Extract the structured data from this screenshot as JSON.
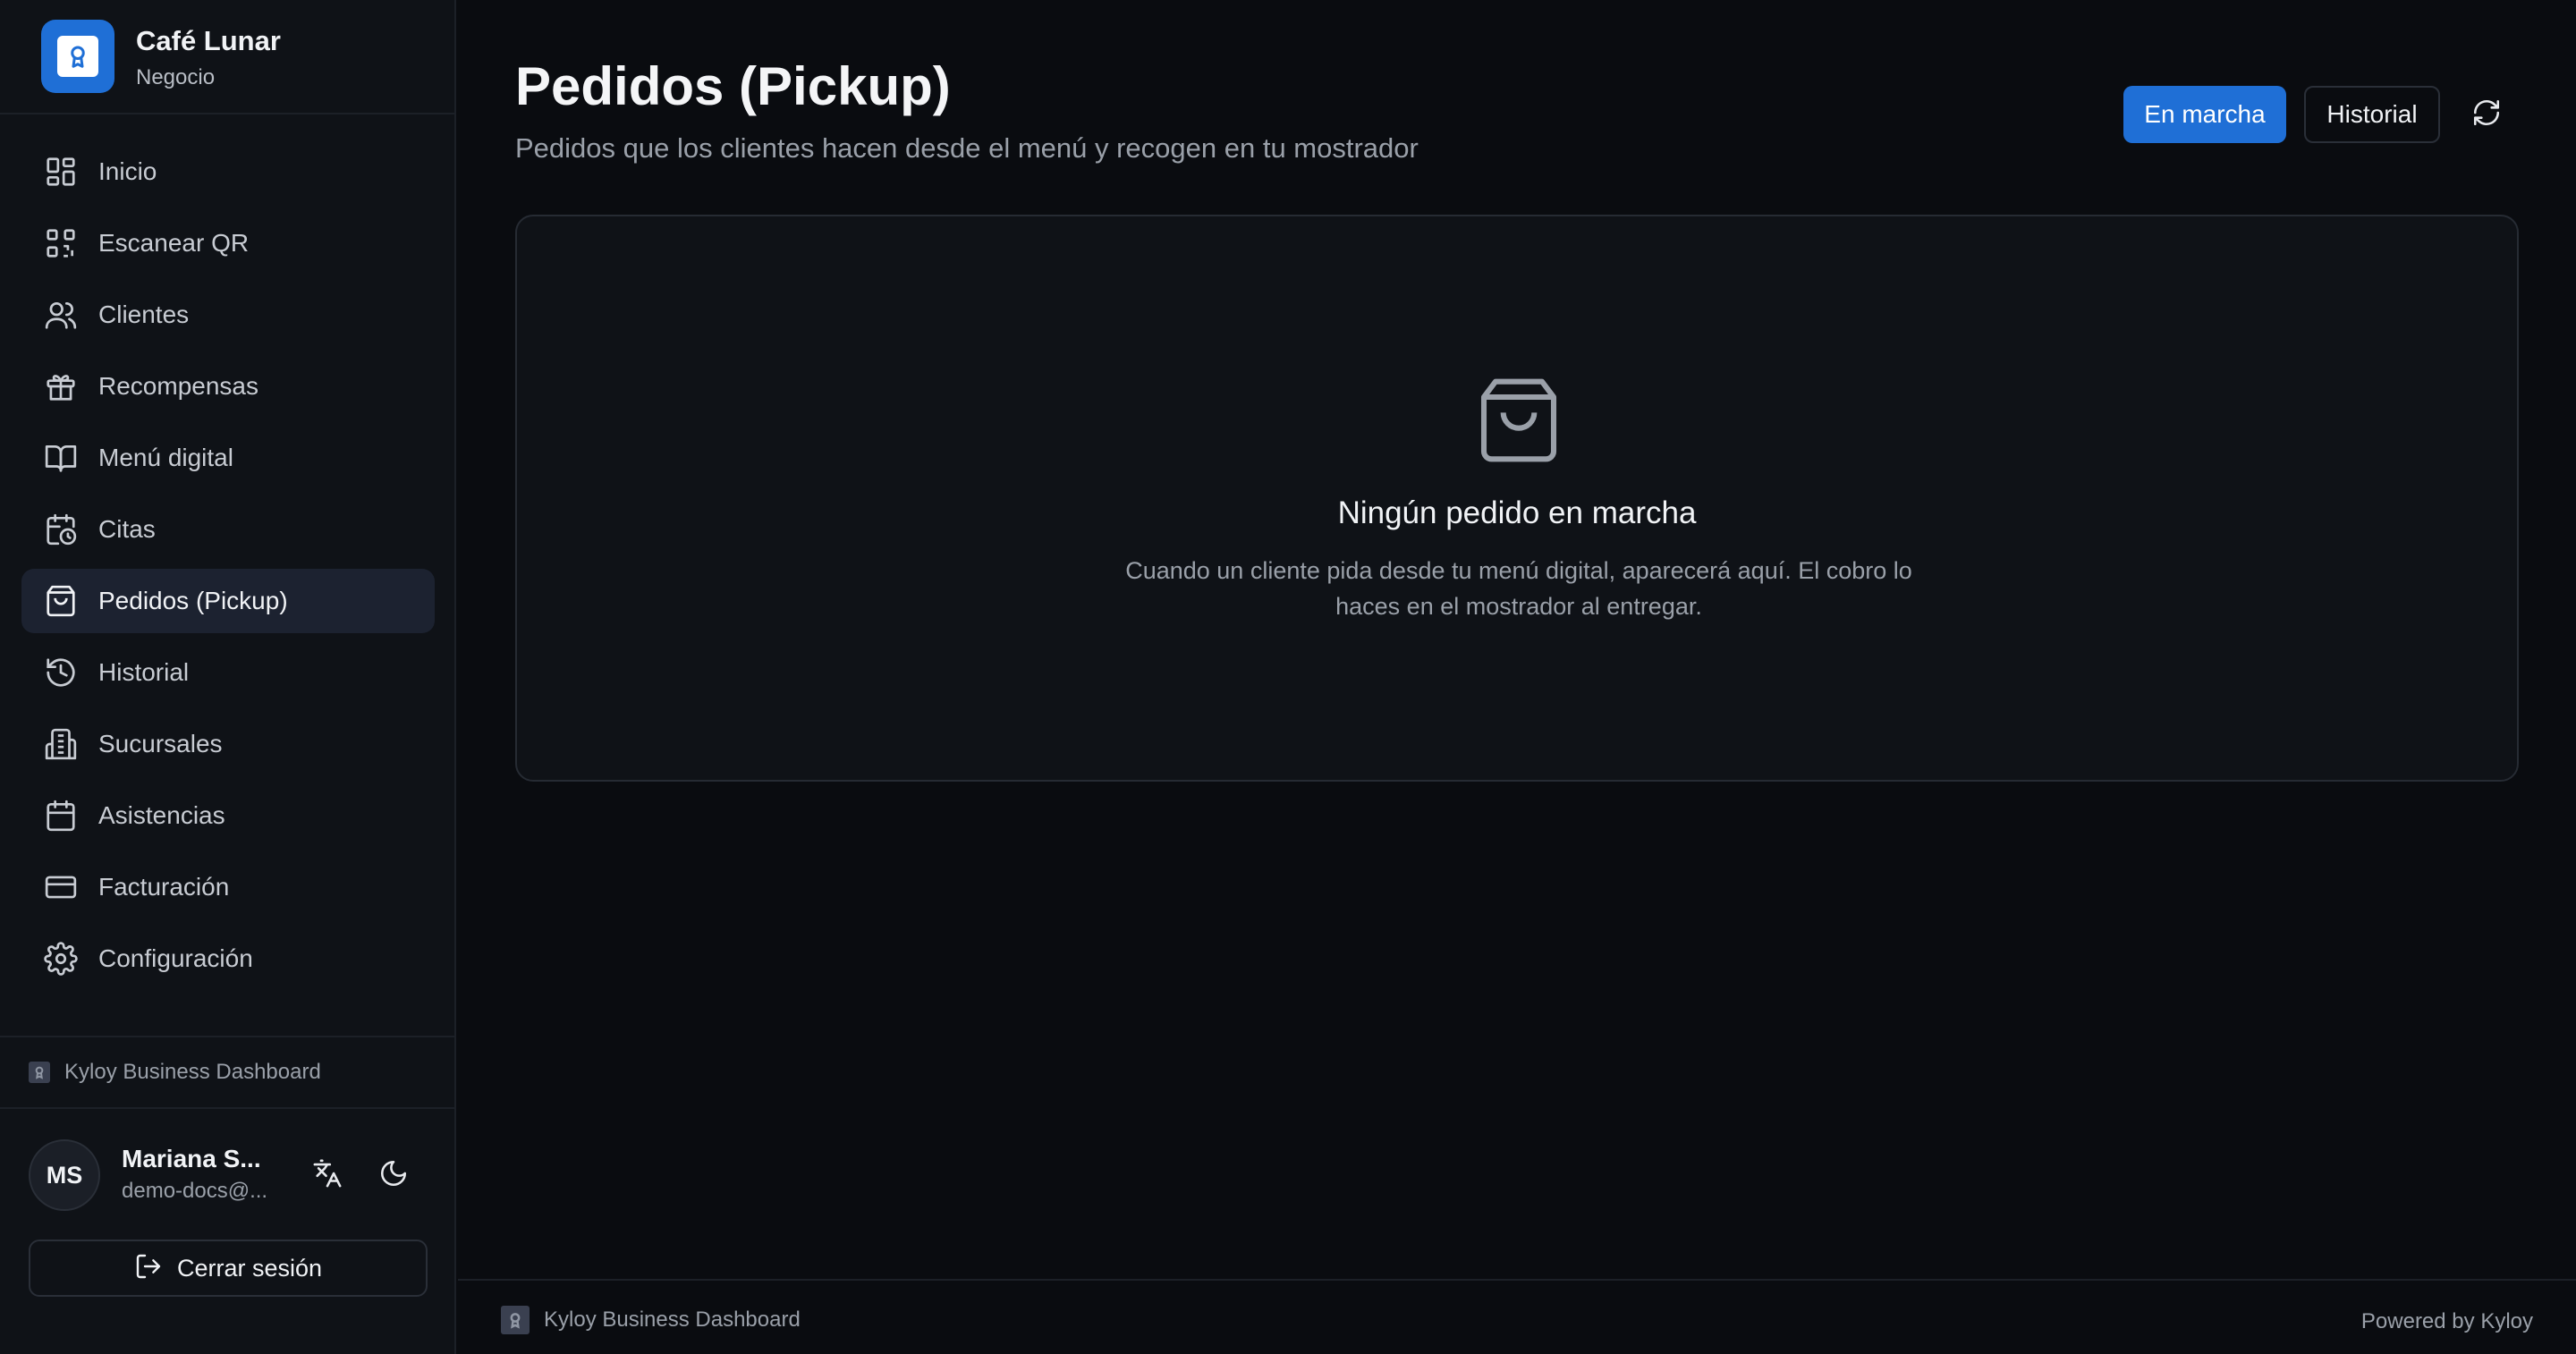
{
  "brand": {
    "name": "Café Lunar",
    "subtitle": "Negocio"
  },
  "sidebar": {
    "items": [
      {
        "label": "Inicio",
        "icon": "dashboard-icon",
        "active": false
      },
      {
        "label": "Escanear QR",
        "icon": "qr-code-icon",
        "active": false
      },
      {
        "label": "Clientes",
        "icon": "users-icon",
        "active": false
      },
      {
        "label": "Recompensas",
        "icon": "gift-icon",
        "active": false
      },
      {
        "label": "Menú digital",
        "icon": "book-open-icon",
        "active": false
      },
      {
        "label": "Citas",
        "icon": "calendar-clock-icon",
        "active": false
      },
      {
        "label": "Pedidos (Pickup)",
        "icon": "shopping-bag-icon",
        "active": true
      },
      {
        "label": "Historial",
        "icon": "history-icon",
        "active": false
      },
      {
        "label": "Sucursales",
        "icon": "building-icon",
        "active": false
      },
      {
        "label": "Asistencias",
        "icon": "calendar-icon",
        "active": false
      },
      {
        "label": "Facturación",
        "icon": "credit-card-icon",
        "active": false
      },
      {
        "label": "Configuración",
        "icon": "gear-icon",
        "active": false
      }
    ],
    "footer_brand": "Kyloy Business Dashboard"
  },
  "user": {
    "initials": "MS",
    "name": "Mariana S...",
    "email": "demo-docs@...",
    "logout_label": "Cerrar sesión"
  },
  "page": {
    "title": "Pedidos (Pickup)",
    "subtitle": "Pedidos que los clientes hacen desde el menú y recogen en tu mostrador",
    "tab_active_label": "En marcha",
    "tab_history_label": "Historial"
  },
  "empty_state": {
    "title": "Ningún pedido en marcha",
    "description": "Cuando un cliente pida desde tu menú digital, aparecerá aquí. El cobro lo haces en el mostrador al entregar."
  },
  "footer": {
    "brand": "Kyloy Business Dashboard",
    "powered": "Powered by Kyloy"
  },
  "colors": {
    "accent": "#1f6fd6",
    "background": "#0a0c10",
    "sidebar": "#0f1217",
    "active_item": "#1c2230"
  }
}
